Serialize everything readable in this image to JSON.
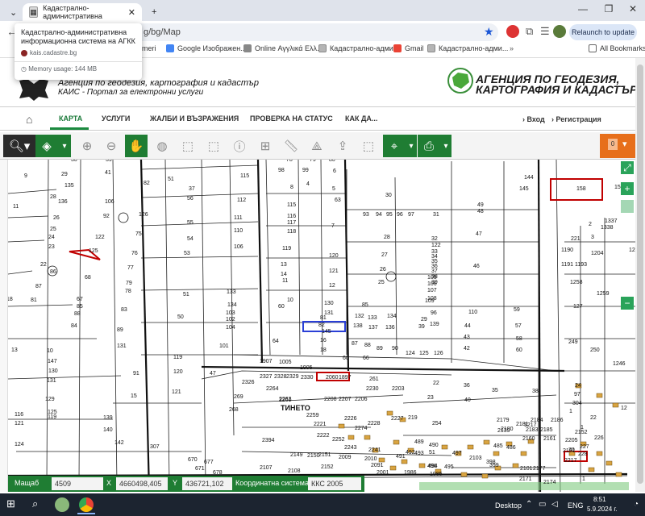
{
  "browser": {
    "tabs": [
      {
        "label": "Кадастрално-административна"
      },
      {
        "label": "Кадастрално-административна"
      }
    ],
    "new_tab": "+",
    "url": "g/bg/Map",
    "relaunch": "Relaunch to update",
    "popup": {
      "title": "Кадастрално-административна информационна система на АГКК",
      "url": "kais.cadastre.bg",
      "memory": "Memory usage: 144 MB"
    },
    "bookmarks": [
      {
        "label": "meri"
      },
      {
        "label": "Google Изображен..."
      },
      {
        "label": "Online Αγγλικά Ελλ..."
      },
      {
        "label": "Кадастрално-адми..."
      },
      {
        "label": "Gmail"
      },
      {
        "label": "Кадастрално-адми..."
      },
      {
        "label": "All Bookmarks"
      }
    ]
  },
  "site": {
    "agency_small": "Агенция по геодезия, картография и кадастър",
    "portal_small": "КАИС - Портал за електронни услуги",
    "big_title_1": "АГЕНЦИЯ ПО ГЕОДЕЗИЯ,",
    "big_title_2": "КАРТОГРАФИЯ И КАДАСТЪР",
    "nav": [
      "КАРТА",
      "УСЛУГИ",
      "ЖАЛБИ И ВЪЗРАЖЕНИЯ",
      "ПРОВЕРКА НА СТАТУС",
      "КАК ДА..."
    ],
    "login": "Вход",
    "register": "Регистрация",
    "layer_count": "0"
  },
  "map": {
    "locality_label": "ТИНЕТО",
    "parcels": [
      [
        "30",
        88,
        200
      ],
      [
        "39",
        131,
        200
      ],
      [
        "9",
        30,
        220
      ],
      [
        "41",
        130,
        216
      ],
      [
        "61",
        240,
        198
      ],
      [
        "78",
        355,
        200
      ],
      [
        "79",
        384,
        200
      ],
      [
        "80",
        408,
        200
      ],
      [
        "163",
        416,
        198
      ],
      [
        "185",
        440,
        198
      ],
      [
        "58",
        520,
        198
      ],
      [
        "144",
        650,
        222
      ],
      [
        "115",
        298,
        220
      ],
      [
        "98",
        345,
        213
      ],
      [
        "99",
        375,
        213
      ],
      [
        "6",
        413,
        214
      ],
      [
        "63",
        415,
        250
      ],
      [
        "29",
        76,
        218
      ],
      [
        "82",
        178,
        229
      ],
      [
        "51",
        208,
        224
      ],
      [
        "37",
        234,
        236
      ],
      [
        "56",
        232,
        248
      ],
      [
        "4",
        380,
        230
      ],
      [
        "8",
        360,
        234
      ],
      [
        "5",
        412,
        236
      ],
      [
        "30",
        478,
        244
      ],
      [
        "31",
        537,
        268
      ],
      [
        "145",
        644,
        236
      ],
      [
        "158",
        715,
        236
      ],
      [
        "157",
        762,
        234
      ],
      [
        "135",
        80,
        232
      ],
      [
        "28",
        62,
        246
      ],
      [
        "136",
        72,
        252
      ],
      [
        "11",
        16,
        258
      ],
      [
        "106",
        130,
        252
      ],
      [
        "93",
        450,
        268
      ],
      [
        "94",
        466,
        268
      ],
      [
        "95",
        479,
        268
      ],
      [
        "96",
        492,
        268
      ],
      [
        "97",
        506,
        268
      ],
      [
        "49",
        592,
        256
      ],
      [
        "48",
        592,
        264
      ],
      [
        "92",
        128,
        270
      ],
      [
        "126",
        172,
        268
      ],
      [
        "112",
        294,
        250
      ],
      [
        "115",
        356,
        256
      ],
      [
        "7",
        411,
        282
      ],
      [
        "1337",
        750,
        276
      ],
      [
        "1338",
        745,
        284
      ],
      [
        "26",
        66,
        272
      ],
      [
        "25",
        62,
        286
      ],
      [
        "24",
        60,
        296
      ],
      [
        "23",
        60,
        308
      ],
      [
        "75",
        168,
        292
      ],
      [
        "110",
        290,
        288
      ],
      [
        "111",
        290,
        272
      ],
      [
        "116",
        356,
        270
      ],
      [
        "117",
        356,
        278
      ],
      [
        "118",
        356,
        289
      ],
      [
        "47",
        590,
        292
      ],
      [
        "2",
        730,
        280
      ],
      [
        "3",
        733,
        296
      ],
      [
        "221",
        708,
        298
      ],
      [
        "122",
        118,
        296
      ],
      [
        "125",
        110,
        313
      ],
      [
        "76",
        163,
        316
      ],
      [
        "54",
        232,
        298
      ],
      [
        "55",
        232,
        278
      ],
      [
        "119",
        350,
        310
      ],
      [
        "120",
        408,
        319
      ],
      [
        "28",
        476,
        296
      ],
      [
        "53",
        228,
        316
      ],
      [
        "106",
        290,
        308
      ],
      [
        "32",
        535,
        298
      ],
      [
        "122",
        535,
        306
      ],
      [
        "33",
        535,
        314
      ],
      [
        "34",
        535,
        320
      ],
      [
        "35",
        535,
        326
      ],
      [
        "36",
        535,
        332
      ],
      [
        "37",
        535,
        338
      ],
      [
        "38",
        535,
        345
      ],
      [
        "39",
        535,
        352
      ],
      [
        "1190",
        696,
        312
      ],
      [
        "1191",
        696,
        330
      ],
      [
        "1193",
        713,
        330
      ],
      [
        "1204",
        733,
        316
      ],
      [
        "22",
        50,
        330
      ],
      [
        "86",
        62,
        339
      ],
      [
        "77",
        158,
        334
      ],
      [
        "68",
        105,
        346
      ],
      [
        "14",
        348,
        342
      ],
      [
        "13",
        348,
        330
      ],
      [
        "121",
        408,
        338
      ],
      [
        "27",
        473,
        318
      ],
      [
        "26",
        471,
        336
      ],
      [
        "25",
        469,
        352
      ],
      [
        "46",
        587,
        332
      ],
      [
        "105",
        530,
        346
      ],
      [
        "106",
        530,
        354
      ],
      [
        "107",
        530,
        362
      ],
      [
        "108",
        530,
        372
      ],
      [
        "79",
        156,
        353
      ],
      [
        "78",
        155,
        363
      ],
      [
        "87",
        44,
        357
      ],
      [
        "18",
        8,
        373
      ],
      [
        "81",
        38,
        374
      ],
      [
        "67",
        95,
        373
      ],
      [
        "85",
        95,
        382
      ],
      [
        "88",
        92,
        391
      ],
      [
        "83",
        150,
        386
      ],
      [
        "12",
        408,
        356
      ],
      [
        "10",
        356,
        374
      ],
      [
        "11",
        350,
        350
      ],
      [
        "133",
        281,
        364
      ],
      [
        "134",
        282,
        380
      ],
      [
        "51",
        227,
        367
      ],
      [
        "1258",
        707,
        352
      ],
      [
        "1259",
        740,
        366
      ],
      [
        "1240",
        780,
        312
      ],
      [
        "109",
        527,
        375
      ],
      [
        "110",
        581,
        389
      ],
      [
        "130",
        402,
        378
      ],
      [
        "131",
        402,
        390
      ],
      [
        "85",
        449,
        380
      ],
      [
        "59",
        637,
        386
      ],
      [
        "127",
        711,
        382
      ],
      [
        "103",
        280,
        390
      ],
      [
        "102",
        280,
        398
      ],
      [
        "104",
        280,
        408
      ],
      [
        "60",
        345,
        382
      ],
      [
        "81",
        397,
        396
      ],
      [
        "82",
        395,
        405
      ],
      [
        "145",
        399,
        413
      ],
      [
        "50",
        220,
        395
      ],
      [
        "132",
        440,
        394
      ],
      [
        "133",
        456,
        396
      ],
      [
        "134",
        480,
        394
      ],
      [
        "96",
        534,
        390
      ],
      [
        "139",
        533,
        404
      ],
      [
        "29",
        522,
        398
      ],
      [
        "44",
        576,
        406
      ],
      [
        "57",
        639,
        406
      ],
      [
        "138",
        438,
        406
      ],
      [
        "137",
        457,
        408
      ],
      [
        "136",
        478,
        408
      ],
      [
        "39",
        519,
        407
      ],
      [
        "89",
        145,
        411
      ],
      [
        "84",
        88,
        406
      ],
      [
        "64",
        338,
        425
      ],
      [
        "16",
        397,
        424
      ],
      [
        "87",
        436,
        428
      ],
      [
        "88",
        452,
        430
      ],
      [
        "89",
        467,
        434
      ],
      [
        "90",
        486,
        434
      ],
      [
        "43",
        575,
        420
      ],
      [
        "58",
        640,
        422
      ],
      [
        "13",
        14,
        436
      ],
      [
        "10",
        58,
        437
      ],
      [
        "101",
        272,
        431
      ],
      [
        "18",
        397,
        436
      ],
      [
        "124",
        503,
        440
      ],
      [
        "125",
        520,
        440
      ],
      [
        "126",
        538,
        440
      ],
      [
        "42",
        575,
        434
      ],
      [
        "60",
        640,
        436
      ],
      [
        "249",
        705,
        426
      ],
      [
        "250",
        732,
        436
      ],
      [
        "131",
        145,
        431
      ],
      [
        "119",
        215,
        445
      ],
      [
        "60",
        425,
        446
      ],
      [
        "66",
        450,
        446
      ],
      [
        "1246",
        760,
        453
      ],
      [
        "147",
        59,
        450
      ],
      [
        "120",
        215,
        463
      ],
      [
        "47",
        260,
        465
      ],
      [
        "1907",
        322,
        450
      ],
      [
        "1005",
        346,
        451
      ],
      [
        "1905",
        372,
        458
      ],
      [
        "91",
        165,
        465
      ],
      [
        "130",
        60,
        462
      ],
      [
        "131",
        58,
        474
      ],
      [
        "2327",
        322,
        469
      ],
      [
        "2328",
        340,
        469
      ],
      [
        "2329",
        355,
        469
      ],
      [
        "2330",
        373,
        470
      ],
      [
        "261",
        458,
        472
      ],
      [
        "2060",
        404,
        470
      ],
      [
        "1897",
        420,
        470
      ],
      [
        "36",
        575,
        480
      ],
      [
        "22",
        537,
        477
      ],
      [
        "35",
        610,
        486
      ],
      [
        "24",
        713,
        480
      ],
      [
        "121",
        213,
        488
      ],
      [
        "15",
        162,
        493
      ],
      [
        "269",
        290,
        494
      ],
      [
        "2264",
        330,
        484
      ],
      [
        "2263",
        346,
        497
      ],
      [
        "2261",
        346,
        498
      ],
      [
        "2326",
        300,
        476
      ],
      [
        "2230",
        454,
        484
      ],
      [
        "2203",
        486,
        484
      ],
      [
        "129",
        56,
        497
      ],
      [
        "97",
        712,
        491
      ],
      [
        "304",
        710,
        502
      ],
      [
        "23",
        530,
        495
      ],
      [
        "219",
        506,
        520
      ],
      [
        "254",
        536,
        527
      ],
      [
        "125",
        59,
        513
      ],
      [
        "2208",
        402,
        497
      ],
      [
        "2207",
        420,
        497
      ],
      [
        "2206",
        440,
        497
      ],
      [
        "40",
        576,
        498
      ],
      [
        "38",
        660,
        487
      ],
      [
        "1",
        706,
        512
      ],
      [
        "22",
        732,
        520
      ],
      [
        "12",
        770,
        508
      ],
      [
        "268",
        284,
        510
      ],
      [
        "2259",
        380,
        517
      ],
      [
        "2221",
        389,
        528
      ],
      [
        "2222",
        393,
        542
      ],
      [
        "2226",
        427,
        521
      ],
      [
        "2228",
        456,
        527
      ],
      [
        "2227",
        485,
        521
      ],
      [
        "1",
        720,
        532
      ],
      [
        "2152",
        713,
        538
      ],
      [
        "119",
        59,
        519
      ],
      [
        "2274",
        440,
        533
      ],
      [
        "1217",
        650,
        529
      ],
      [
        "116",
        18,
        516
      ],
      [
        "140",
        128,
        535
      ],
      [
        "139",
        128,
        520
      ],
      [
        "121",
        18,
        527
      ],
      [
        "142",
        142,
        551
      ],
      [
        "124",
        18,
        553
      ],
      [
        "2394",
        325,
        548
      ],
      [
        "2252",
        412,
        547
      ],
      [
        "2243",
        427,
        557
      ],
      [
        "2241",
        457,
        560
      ],
      [
        "489",
        514,
        550
      ],
      [
        "490",
        532,
        554
      ],
      [
        "2139",
        617,
        536
      ],
      [
        "2160",
        648,
        546
      ],
      [
        "2161",
        674,
        546
      ],
      [
        "2179",
        616,
        523
      ],
      [
        "2184",
        658,
        523
      ],
      [
        "2186",
        683,
        523
      ],
      [
        "2180",
        621,
        534
      ],
      [
        "2181",
        640,
        528
      ],
      [
        "2183",
        652,
        535
      ],
      [
        "2185",
        670,
        535
      ],
      [
        "2205",
        701,
        548
      ],
      [
        "51",
        532,
        563
      ],
      [
        "2191",
        698,
        561
      ],
      [
        "2217",
        700,
        573
      ],
      [
        "227",
        719,
        556
      ],
      [
        "228",
        717,
        565
      ],
      [
        "226",
        737,
        545
      ],
      [
        "2010",
        452,
        571
      ],
      [
        "2149",
        360,
        566
      ],
      [
        "2150",
        381,
        567
      ],
      [
        "2151",
        395,
        566
      ],
      [
        "2009",
        420,
        569
      ],
      [
        "491",
        491,
        568
      ],
      [
        "492",
        503,
        563
      ],
      [
        "493",
        514,
        564
      ],
      [
        "494",
        531,
        580
      ],
      [
        "495",
        551,
        581
      ],
      [
        "496",
        530,
        580
      ],
      [
        "1985",
        533,
        590
      ],
      [
        "398",
        603,
        575
      ],
      [
        "399",
        607,
        579
      ],
      [
        "2101",
        645,
        583
      ],
      [
        "2177",
        661,
        583
      ],
      [
        "486",
        628,
        557
      ],
      [
        "485",
        612,
        555
      ],
      [
        "2103",
        582,
        570
      ],
      [
        "497",
        561,
        564
      ],
      [
        "307",
        186,
        556
      ],
      [
        "2107",
        322,
        582
      ],
      [
        "2152",
        398,
        581
      ],
      [
        "2091",
        460,
        579
      ],
      [
        "2001",
        467,
        588
      ],
      [
        "70",
        705,
        560
      ],
      [
        "670",
        233,
        572
      ],
      [
        "671",
        242,
        583
      ],
      [
        "677",
        253,
        575
      ],
      [
        "678",
        264,
        588
      ],
      [
        "2108",
        357,
        586
      ],
      [
        "1986",
        501,
        588
      ],
      [
        "2171",
        644,
        596
      ],
      [
        "2174",
        674,
        600
      ],
      [
        "1",
        722,
        596
      ]
    ],
    "circle_labels": [
      [
        "6",
        150,
        273
      ],
      [
        "7",
        482,
        346
      ],
      [
        "86",
        62,
        339
      ]
    ]
  },
  "statusbar": {
    "scale_label": "Мащаб",
    "scale_value": "4509",
    "x_label": "X",
    "x_value": "4660498,405",
    "y_label": "Y",
    "y_value": "436721,102",
    "crs_label": "Координатна система",
    "crs_value": "ККС 2005"
  },
  "taskbar": {
    "desktop": "Desktop",
    "lang": "ENG",
    "time": "8:51",
    "date": "5.9.2024 г."
  },
  "colors": {
    "brand_green": "#1f7d33",
    "accent_orange": "#e76f1b",
    "parcel_red": "#c00000",
    "parcel_blue": "#2a3fd6"
  }
}
